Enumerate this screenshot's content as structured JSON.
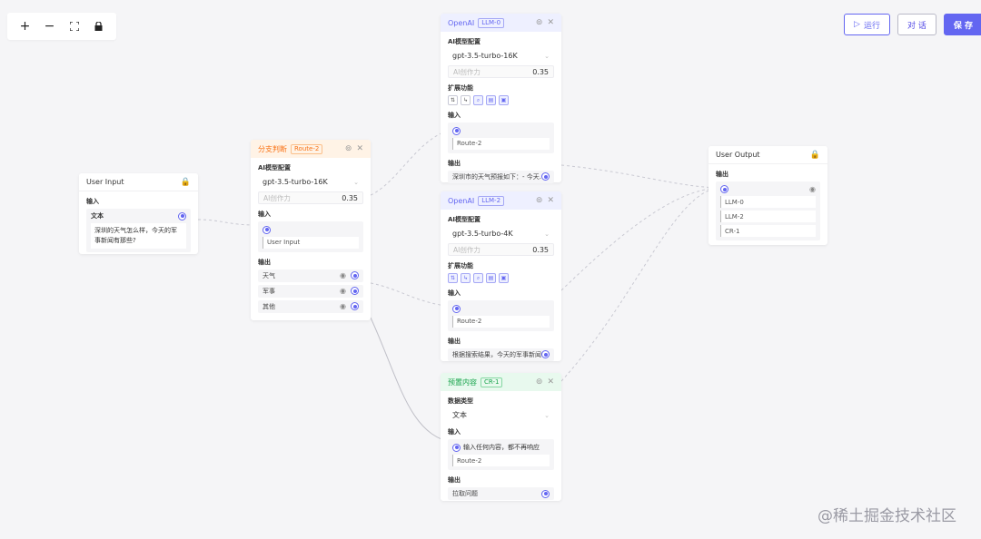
{
  "toolbar": {
    "zoom_in": "+",
    "zoom_out": "−",
    "fit": "⛶",
    "lock": "🔒"
  },
  "top_buttons": {
    "run_label": "运行",
    "chat_label": "对 话",
    "save_label": "保 存"
  },
  "user_input": {
    "title": "User Input",
    "input_label": "输入",
    "text_label": "文本",
    "text_value": "深圳的天气怎么样，今天的军事新闻有那些?"
  },
  "route": {
    "title": "分支判断",
    "tag": "Route-2",
    "ai_config_label": "AI模型配置",
    "model": "gpt-3.5-turbo-16K",
    "creativity_label": "AI创作力",
    "creativity_value": "0.35",
    "input_label": "输入",
    "input_source": "User Input",
    "output_label": "输出",
    "outputs": [
      "天气",
      "军事",
      "其他"
    ]
  },
  "llm0": {
    "title": "OpenAI",
    "tag": "LLM-0",
    "ai_config_label": "AI模型配置",
    "model": "gpt-3.5-turbo-16K",
    "creativity_label": "AI创作力",
    "creativity_value": "0.35",
    "ext_label": "扩展功能",
    "input_label": "输入",
    "input_source": "Route-2",
    "output_label": "输出",
    "output_text": "深圳市的天气预报如下：- 今天..."
  },
  "llm2": {
    "title": "OpenAI",
    "tag": "LLM-2",
    "ai_config_label": "AI模型配置",
    "model": "gpt-3.5-turbo-4K",
    "creativity_label": "AI创作力",
    "creativity_value": "0.35",
    "ext_label": "扩展功能",
    "input_label": "输入",
    "input_source": "Route-2",
    "output_label": "输出",
    "output_text": "根据搜索结果，今天的军事新闻..."
  },
  "cr": {
    "title": "预置内容",
    "tag": "CR-1",
    "data_type_label": "数据类型",
    "data_type_value": "文本",
    "input_label": "输入",
    "input_text": "输入任何内容，都不再响应",
    "input_source": "Route-2",
    "output_label": "输出",
    "output_text": "拉取问题"
  },
  "user_output": {
    "title": "User Output",
    "output_label": "输出",
    "sources": [
      "LLM-0",
      "LLM-2",
      "CR-1"
    ]
  },
  "watermark": "@稀土掘金技术社区",
  "colors": {
    "accent": "#6366f1",
    "route_header": "#fff3e6",
    "llm_header": "#eef0ff",
    "cr_header": "#e8f9ee",
    "background": "#f5f5f7"
  }
}
